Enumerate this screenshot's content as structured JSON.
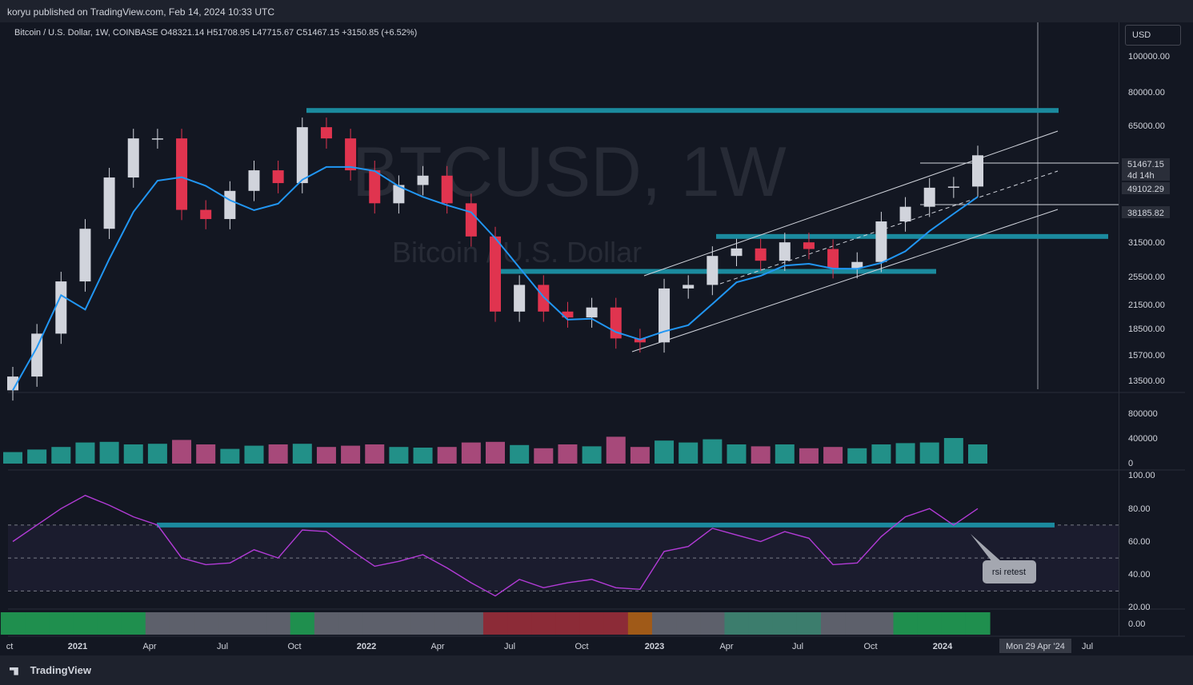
{
  "header": {
    "published_by": "koryu published on TradingView.com, Feb 14, 2024 10:33 UTC"
  },
  "legend": {
    "symbol": "Bitcoin / U.S. Dollar, 1W, COINBASE",
    "open": "O48321.14",
    "high": "H51708.95",
    "low": "L47715.67",
    "close": "C51467.15",
    "change": "+3150.85 (+6.52%)"
  },
  "watermark": {
    "ticker": "BTCUSD, 1W",
    "name": "Bitcoin / U.S. Dollar"
  },
  "currency_label": "USD",
  "price_labels": {
    "last": "51467.15",
    "countdown": "4d 14h",
    "level_1": "49102.29",
    "level_2": "38185.82"
  },
  "annotation": {
    "rsi_retest": "rsi retest"
  },
  "crosshair_date": "Mon 29 Apr '24",
  "footer": {
    "brand": "TradingView"
  },
  "colors": {
    "background": "#131722",
    "bull": "#d1d4dc",
    "bear": "#e0344f",
    "teal_zone": "#1b8a9e",
    "rsi_line": "#b23bd6",
    "ma_blue": "#2196f3"
  },
  "chart_data": [
    {
      "type": "line",
      "title": "Bitcoin / U.S. Dollar, 1W, COINBASE",
      "scale": "log",
      "ylim": [
        12500,
        115000
      ],
      "y_ticks": [
        "100000.00",
        "80000.00",
        "65000.00",
        "51467.15",
        "31500.00",
        "25500.00",
        "21500.00",
        "18500.00",
        "15700.00",
        "13500.00"
      ],
      "x_ticks": [
        "ct",
        "2021",
        "Apr",
        "Jul",
        "Oct",
        "2022",
        "Apr",
        "Jul",
        "Oct",
        "2023",
        "Apr",
        "Jul",
        "Oct",
        "2024",
        "Apr",
        "Jul"
      ],
      "x": [
        "2020-10",
        "2020-11",
        "2020-12",
        "2021-01",
        "2021-02",
        "2021-03",
        "2021-04",
        "2021-05",
        "2021-06",
        "2021-07",
        "2021-08",
        "2021-09",
        "2021-10",
        "2021-11",
        "2021-12",
        "2022-01",
        "2022-02",
        "2022-03",
        "2022-04",
        "2022-05",
        "2022-06",
        "2022-07",
        "2022-08",
        "2022-09",
        "2022-10",
        "2022-11",
        "2022-12",
        "2023-01",
        "2023-02",
        "2023-03",
        "2023-04",
        "2023-05",
        "2023-06",
        "2023-07",
        "2023-08",
        "2023-09",
        "2023-10",
        "2023-11",
        "2023-12",
        "2024-01",
        "2024-02"
      ],
      "series": [
        {
          "name": "",
          "values": [
            13500,
            17500,
            24000,
            33000,
            45000,
            57000,
            57000,
            37000,
            35000,
            41500,
            47000,
            43500,
            61000,
            57000,
            47000,
            38500,
            43000,
            45500,
            38500,
            31500,
            20000,
            23500,
            20000,
            19300,
            20500,
            17000,
            16600,
            23000,
            23500,
            28000,
            29300,
            27200,
            30400,
            29200,
            26000,
            27000,
            34500,
            37700,
            42300,
            42600,
            51467
          ]
        }
      ],
      "horizontal_levels": [
        67500,
        49102.29,
        38185.82,
        31500,
        25500
      ],
      "last_value": 51467.15
    },
    {
      "type": "bar",
      "title": "",
      "ylim": [
        0,
        1000000
      ],
      "y_ticks": [
        "800000",
        "400000",
        "0"
      ],
      "series": [
        {
          "name": "",
          "values": [
            180000,
            220000,
            260000,
            330000,
            340000,
            300000,
            310000,
            370000,
            300000,
            230000,
            280000,
            300000,
            310000,
            260000,
            280000,
            300000,
            260000,
            250000,
            260000,
            330000,
            340000,
            290000,
            240000,
            300000,
            270000,
            420000,
            260000,
            360000,
            330000,
            380000,
            300000,
            270000,
            300000,
            240000,
            260000,
            240000,
            300000,
            320000,
            330000,
            400000,
            300000
          ]
        }
      ]
    },
    {
      "type": "line",
      "title": "",
      "ylim": [
        20,
        100
      ],
      "y_ticks": [
        "100.00",
        "80.00",
        "60.00",
        "40.00",
        "20.00"
      ],
      "series": [
        {
          "name": "",
          "values": [
            60,
            70,
            80,
            88,
            82,
            75,
            70,
            50,
            46,
            47,
            55,
            50,
            67,
            66,
            55,
            45,
            48,
            52,
            44,
            35,
            27,
            37,
            32,
            35,
            37,
            32,
            31,
            54,
            57,
            68,
            64,
            60,
            66,
            62,
            46,
            47,
            63,
            75,
            80,
            70,
            80
          ]
        }
      ],
      "horizontal_levels": [
        70,
        50,
        30
      ]
    },
    {
      "type": "heatmap",
      "title": "",
      "y_ticks": [
        "0.00"
      ],
      "series": [
        {
          "name": "",
          "values": [
            "green",
            "green",
            "green",
            "green",
            "green",
            "green",
            "grey",
            "grey",
            "grey",
            "grey",
            "grey",
            "grey",
            "green",
            "grey",
            "grey",
            "grey",
            "grey",
            "grey",
            "grey",
            "grey",
            "red",
            "red",
            "red",
            "red",
            "red",
            "red",
            "orange",
            "grey",
            "grey",
            "grey",
            "teal",
            "teal",
            "teal",
            "teal",
            "grey",
            "grey",
            "grey",
            "green",
            "green",
            "green",
            "green"
          ]
        }
      ]
    }
  ]
}
